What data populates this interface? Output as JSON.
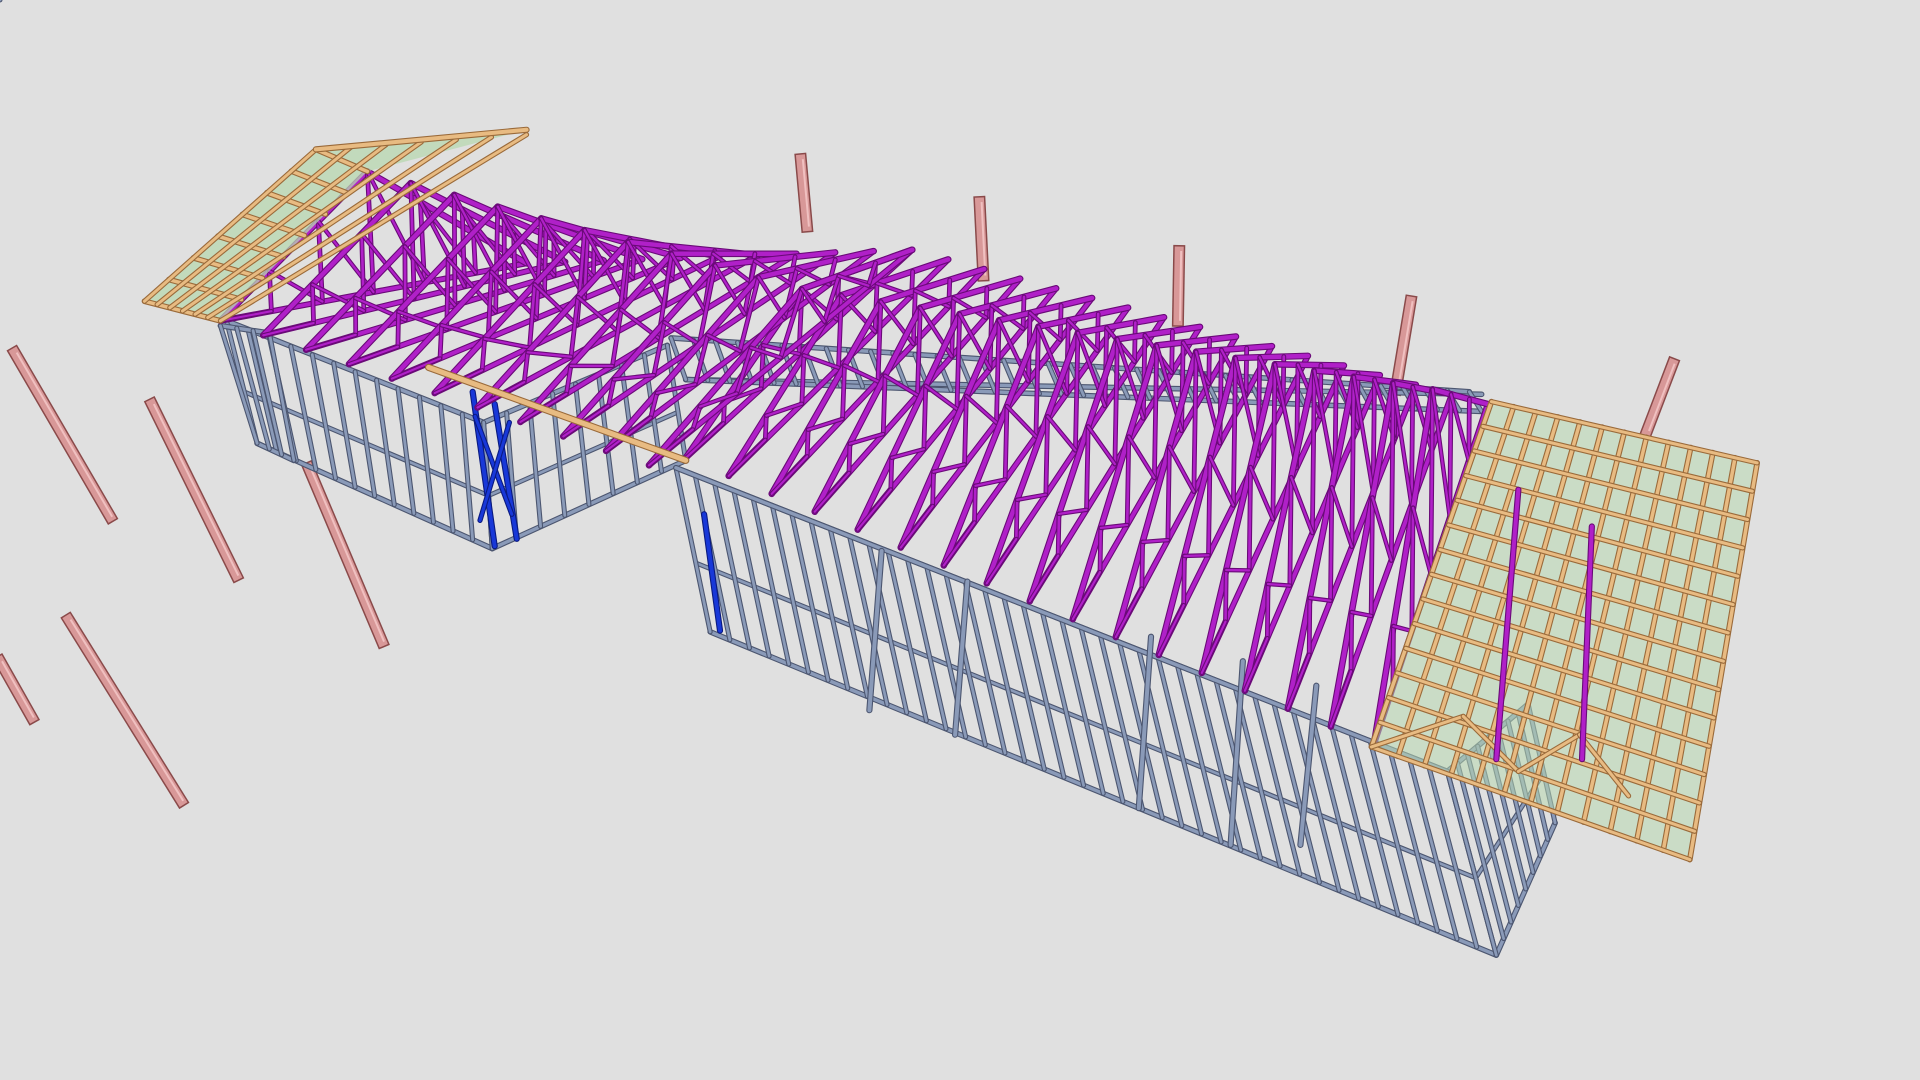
{
  "scene": {
    "background": "#e0e0e0",
    "colors": {
      "wall_frame": "#8a9ab8",
      "wall_frame_dark": "#4c5670",
      "truss": "#b020c8",
      "truss_dark": "#6a0a78",
      "bracing": "#1838d8",
      "timber": "#e8bb82",
      "timber_dark": "#9a6a3a",
      "sheathing": "#b8d8b0",
      "post": "#d89898",
      "post_dark": "#8a4a4a"
    }
  }
}
